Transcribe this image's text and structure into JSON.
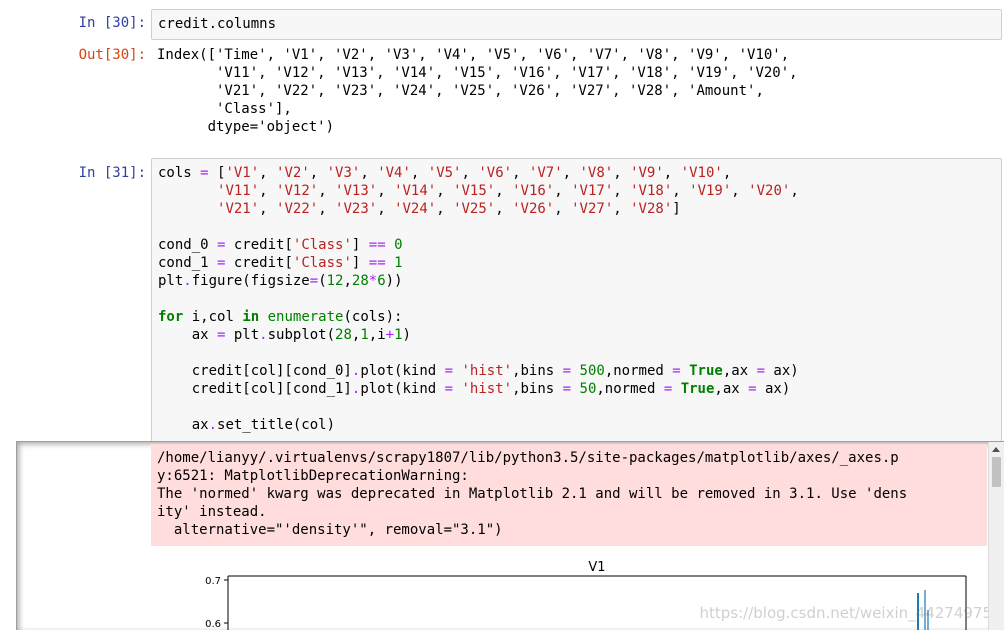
{
  "cells": [
    {
      "prompt_in": "In [30]:",
      "code": "credit.columns",
      "prompt_out": "Out[30]:",
      "output": "Index(['Time', 'V1', 'V2', 'V3', 'V4', 'V5', 'V6', 'V7', 'V8', 'V9', 'V10',\n       'V11', 'V12', 'V13', 'V14', 'V15', 'V16', 'V17', 'V18', 'V19', 'V20',\n       'V21', 'V22', 'V23', 'V24', 'V25', 'V26', 'V27', 'V28', 'Amount',\n       'Class'],\n      dtype='object')"
    },
    {
      "prompt_in": "In [31]:",
      "stderr": "/home/lianyy/.virtualenvs/scrapy1807/lib/python3.5/site-packages/matplotlib/axes/_axes.p\ny:6521: MatplotlibDeprecationWarning:\nThe 'normed' kwarg was deprecated in Matplotlib 2.1 and will be removed in 3.1. Use 'dens\nity' instead.\n  alternative=\"'density'\", removal=\"3.1\")"
    }
  ],
  "code31": {
    "cols": [
      "'V1'",
      "'V2'",
      "'V3'",
      "'V4'",
      "'V5'",
      "'V6'",
      "'V7'",
      "'V8'",
      "'V9'",
      "'V10'",
      "'V11'",
      "'V12'",
      "'V13'",
      "'V14'",
      "'V15'",
      "'V16'",
      "'V17'",
      "'V18'",
      "'V19'",
      "'V20'",
      "'V21'",
      "'V22'",
      "'V23'",
      "'V24'",
      "'V25'",
      "'V26'",
      "'V27'",
      "'V28'"
    ]
  },
  "chart_data": {
    "type": "bar",
    "title": "V1",
    "y_ticks": [
      "0.7",
      "0.6"
    ],
    "ylim_visible": [
      0.58,
      0.72
    ]
  },
  "watermark": "https://blog.csdn.net/weixin_44274975",
  "colors": {
    "prompt_in": "#303F9F",
    "prompt_out": "#D84315",
    "stderr_bg": "#ffdddd",
    "hist_bar": "#1f77b4"
  }
}
